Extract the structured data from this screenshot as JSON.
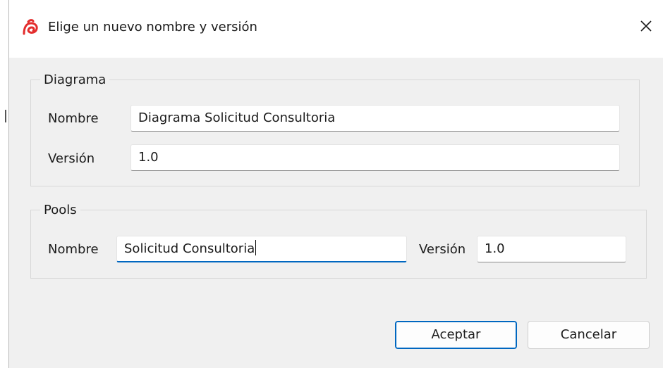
{
  "window": {
    "title": "Elige un nuevo nombre y versión",
    "app_icon": "bonita-logo-icon",
    "close_icon": "close-icon",
    "accent_color": "#0067c0",
    "logo_color": "#e32d2d"
  },
  "diagram_group": {
    "legend": "Diagrama",
    "name_label": "Nombre",
    "name_value": "Diagrama Solicitud Consultoria",
    "version_label": "Versión",
    "version_value": "1.0"
  },
  "pools_group": {
    "legend": "Pools",
    "name_label": "Nombre",
    "name_value": "Solicitud Consultoria",
    "version_label": "Versión",
    "version_value": "1.0"
  },
  "buttons": {
    "accept_label": "Aceptar",
    "cancel_label": "Cancelar"
  }
}
